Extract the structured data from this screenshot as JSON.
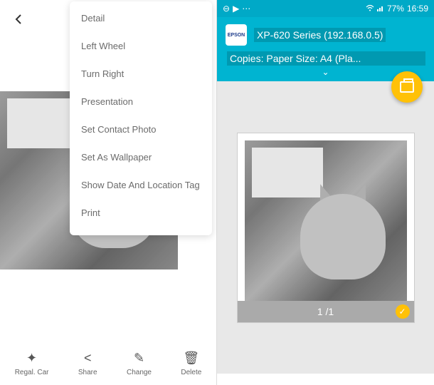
{
  "left": {
    "menu": {
      "items": [
        "Detail",
        "Left Wheel",
        "Turn Right",
        "Presentation",
        "Set Contact Photo",
        "Set As Wallpaper",
        "Show Date And Location Tag",
        "Print"
      ]
    },
    "toolbar": {
      "regal": "Regal. Car",
      "share": "Share",
      "change": "Change",
      "delete": "Delete"
    }
  },
  "right": {
    "status": {
      "battery": "77%",
      "time": "16:59"
    },
    "printer": {
      "brand": "EPSON",
      "name": "XP-620 Series (192.168.0.5)",
      "settings": "Copies: Paper Size: A4 (Pla..."
    },
    "preview": {
      "page": "1 /1"
    }
  }
}
